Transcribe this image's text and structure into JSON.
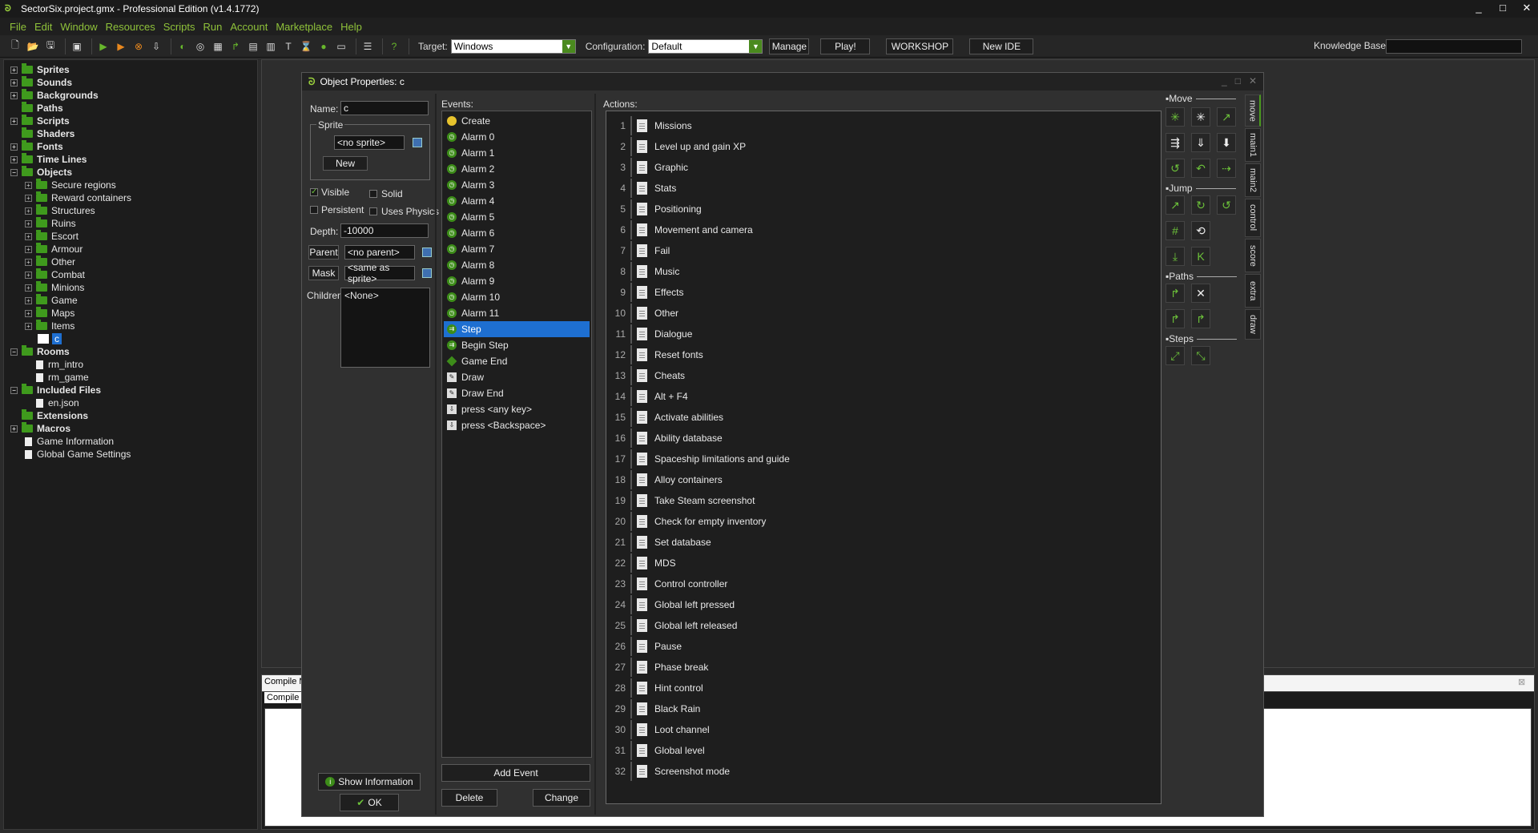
{
  "window": {
    "title": "SectorSix.project.gmx  -  Professional Edition (v1.4.1772)",
    "controls": [
      "_",
      "□",
      "✕"
    ]
  },
  "menu": [
    "File",
    "Edit",
    "Window",
    "Resources",
    "Scripts",
    "Run",
    "Account",
    "Marketplace",
    "Help"
  ],
  "toolbar": {
    "target_label": "Target:",
    "target_value": "Windows",
    "config_label": "Configuration:",
    "config_value": "Default",
    "manage": "Manage",
    "play": "Play!",
    "workshop": "WORKSHOP",
    "new_ide": "New IDE",
    "kb_label": "Knowledge Base:"
  },
  "tree": {
    "folders": [
      "Sprites",
      "Sounds",
      "Backgrounds",
      "Paths",
      "Scripts",
      "Shaders",
      "Fonts",
      "Time Lines",
      "Objects"
    ],
    "object_groups": [
      "Secure regions",
      "Reward containers",
      "Structures",
      "Ruins",
      "Escort",
      "Armour",
      "Other",
      "Combat",
      "Minions",
      "Game",
      "Maps",
      "Items"
    ],
    "selected_object": "c",
    "rooms_label": "Rooms",
    "rooms": [
      "rm_intro",
      "rm_game"
    ],
    "included_label": "Included Files",
    "included": [
      "en.json"
    ],
    "extensions_label": "Extensions",
    "macros_label": "Macros",
    "game_info": "Game Information",
    "global_settings": "Global Game Settings"
  },
  "behind": {
    "compile_tab1": "Compile M",
    "compile_tab2": "Compile"
  },
  "dialog": {
    "title": "Object Properties: c",
    "name_label": "Name:",
    "name_value": "c",
    "sprite_group": "Sprite",
    "sprite_value": "<no sprite>",
    "new_btn": "New",
    "visible": "Visible",
    "solid": "Solid",
    "persistent": "Persistent",
    "uses_physics": "Uses Physics",
    "depth_label": "Depth:",
    "depth_value": "-10000",
    "parent_btn": "Parent",
    "parent_value": "<no parent>",
    "mask_btn": "Mask",
    "mask_value": "<same as sprite>",
    "children_label": "Children:",
    "children_value": "<None>",
    "show_info": "Show Information",
    "ok": "OK",
    "events_label": "Events:",
    "events": [
      "Create",
      "Alarm 0",
      "Alarm 1",
      "Alarm 2",
      "Alarm 3",
      "Alarm 4",
      "Alarm 5",
      "Alarm 6",
      "Alarm 7",
      "Alarm 8",
      "Alarm 9",
      "Alarm 10",
      "Alarm 11",
      "Step",
      "Begin Step",
      "Game End",
      "Draw",
      "Draw End",
      "press <any key>",
      "press <Backspace>"
    ],
    "selected_event": "Step",
    "add_event": "Add Event",
    "delete": "Delete",
    "change": "Change",
    "actions_label": "Actions:",
    "actions": [
      "Missions",
      "Level up and gain XP",
      "Graphic",
      "Stats",
      "Positioning",
      "Movement and camera",
      "Fail",
      "Music",
      "Effects",
      "Other",
      "Dialogue",
      "Reset fonts",
      "Cheats",
      "Alt + F4",
      "Activate abilities",
      "Ability database",
      "Spaceship limitations and guide",
      "Alloy containers",
      "Take Steam screenshot",
      "Check for empty inventory",
      "Set database",
      "MDS",
      "Control controller",
      "Global left pressed",
      "Global left released",
      "Pause",
      "Phase break",
      "Hint control",
      "Black Rain",
      "Loot channel",
      "Global level",
      "Screenshot mode"
    ]
  },
  "palette": {
    "sections": [
      "Move",
      "Jump",
      "Paths",
      "Steps"
    ],
    "tabs": [
      "move",
      "main1",
      "main2",
      "control",
      "score",
      "extra",
      "draw"
    ]
  }
}
